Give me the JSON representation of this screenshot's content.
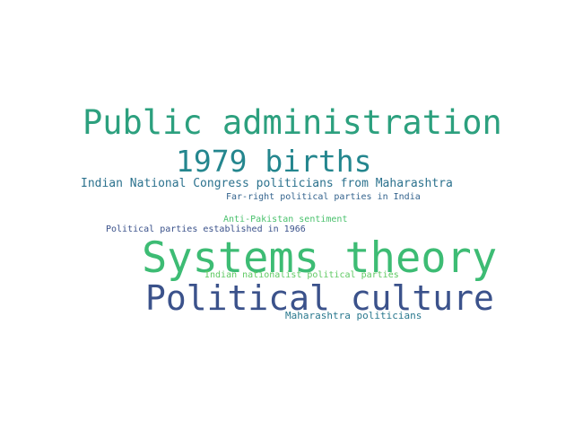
{
  "words": [
    {
      "text": "Public administration",
      "color": "#2ca07e"
    },
    {
      "text": "1979 births",
      "color": "#24868e"
    },
    {
      "text": "Indian National Congress politicians from Maharashtra",
      "color": "#2c728e"
    },
    {
      "text": "Far-right political parties in India",
      "color": "#33638d"
    },
    {
      "text": "Anti-Pakistan sentiment",
      "color": "#4ac16d"
    },
    {
      "text": "Political parties established in 1966",
      "color": "#3b528b"
    },
    {
      "text": "Systems theory",
      "color": "#3dbc74"
    },
    {
      "text": "Indian nationalist political parties",
      "color": "#5ec962"
    },
    {
      "text": "Political culture",
      "color": "#3b528b"
    },
    {
      "text": "Maharashtra politicians",
      "color": "#2a788e"
    }
  ]
}
